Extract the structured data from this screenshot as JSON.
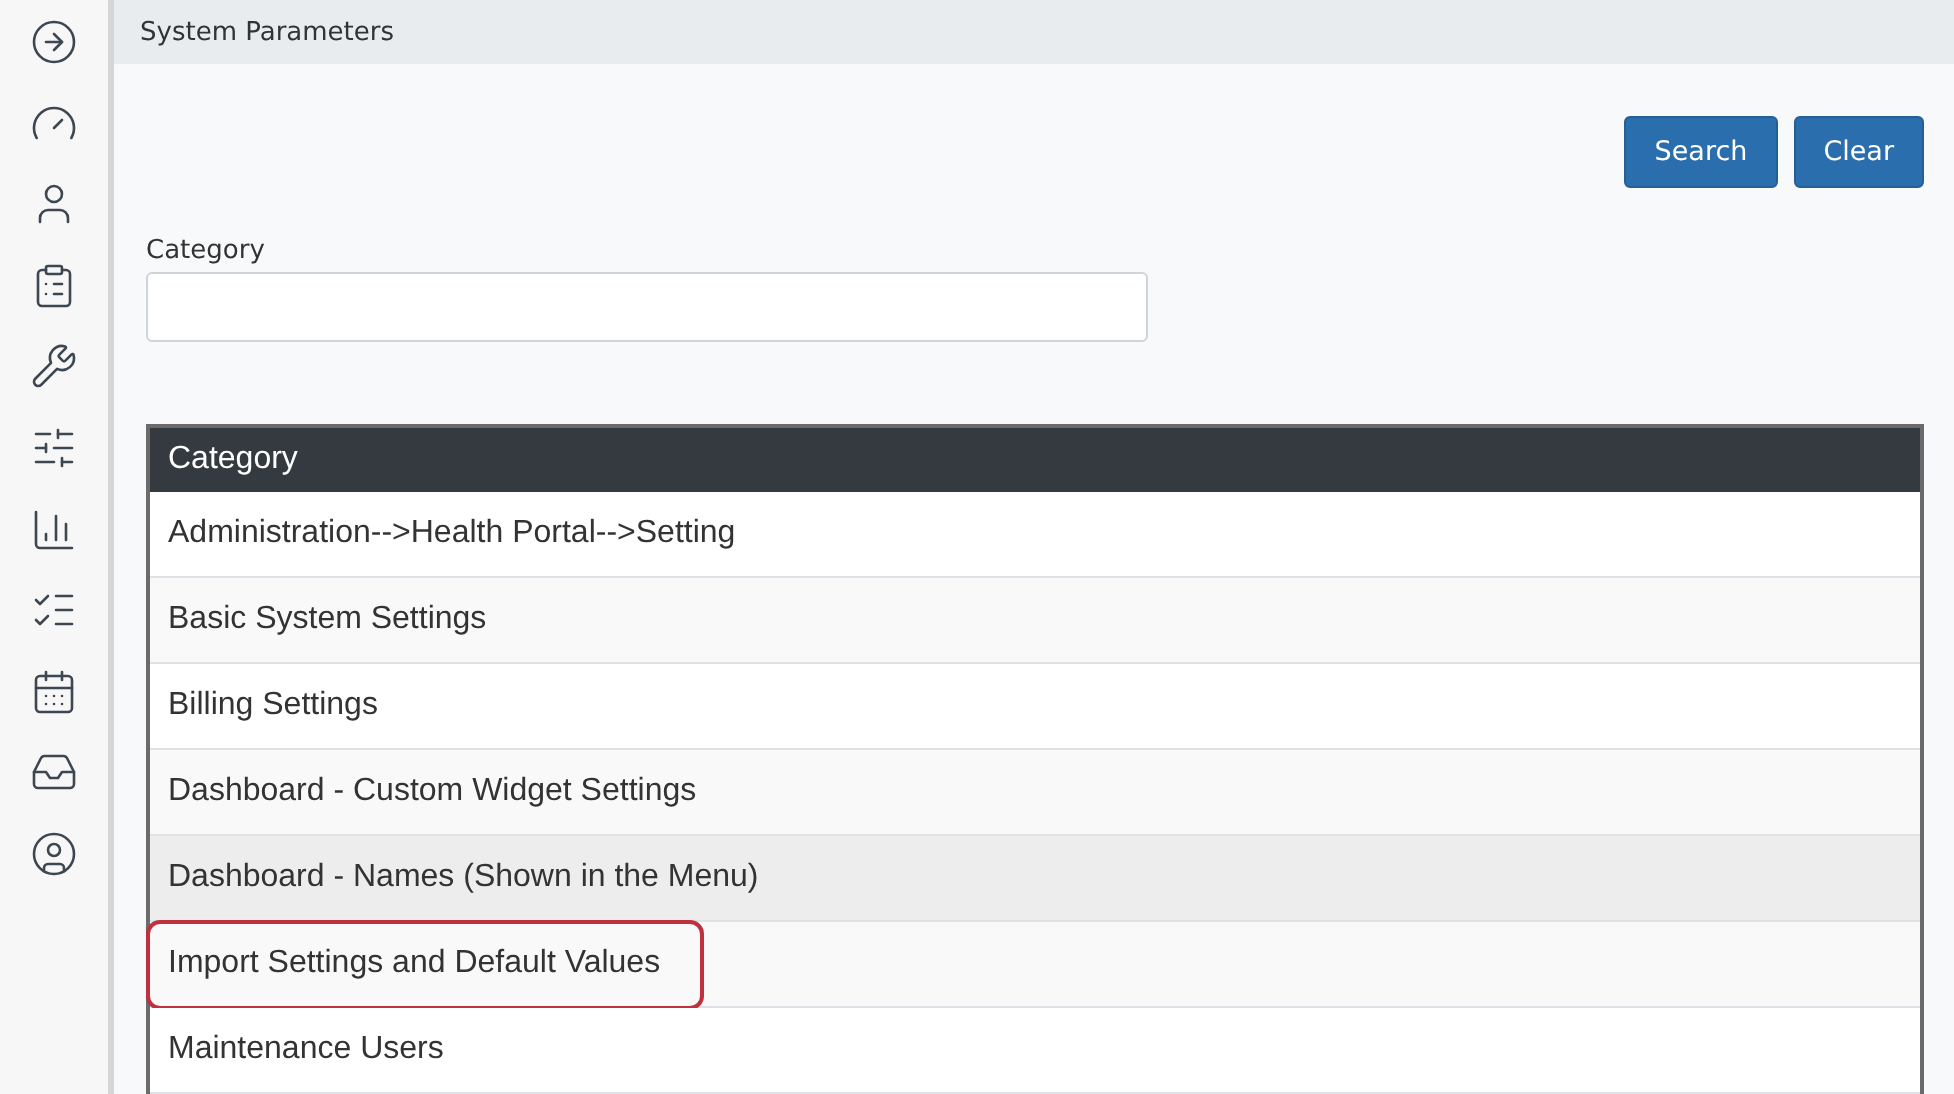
{
  "page_title": "System Parameters",
  "buttons": [
    "Search",
    "Clear"
  ],
  "filter": {
    "label": "Category"
  },
  "table": {
    "columns": [
      "Category"
    ],
    "rows": [
      {
        "category": "Administration-->Health Portal-->Setting",
        "selected": false,
        "outlined": false
      },
      {
        "category": "Basic System Settings",
        "selected": false,
        "outlined": false
      },
      {
        "category": "Billing Settings",
        "selected": false,
        "outlined": false
      },
      {
        "category": "Dashboard - Custom Widget Settings",
        "selected": false,
        "outlined": false
      },
      {
        "category": "Dashboard - Names (Shown in the Menu)",
        "selected": true,
        "outlined": false
      },
      {
        "category": "Import Settings and Default Values",
        "selected": false,
        "outlined": true
      },
      {
        "category": "Maintenance Users",
        "selected": false,
        "outlined": false
      }
    ]
  }
}
